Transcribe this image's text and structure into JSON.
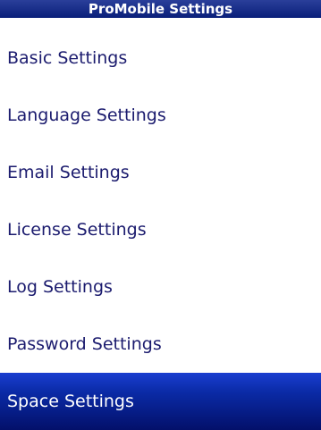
{
  "header": {
    "title": "ProMobile Settings"
  },
  "menu": {
    "items": [
      {
        "label": "Basic Settings",
        "selected": false
      },
      {
        "label": "Language Settings",
        "selected": false
      },
      {
        "label": "Email Settings",
        "selected": false
      },
      {
        "label": "License Settings",
        "selected": false
      },
      {
        "label": "Log Settings",
        "selected": false
      },
      {
        "label": "Password Settings",
        "selected": false
      },
      {
        "label": "Space Settings",
        "selected": true
      }
    ]
  },
  "colors": {
    "title_bar": "#0a1f7a",
    "item_text": "#1b1b6e",
    "selection": "#0a2aa5",
    "background": "#ffffff"
  }
}
